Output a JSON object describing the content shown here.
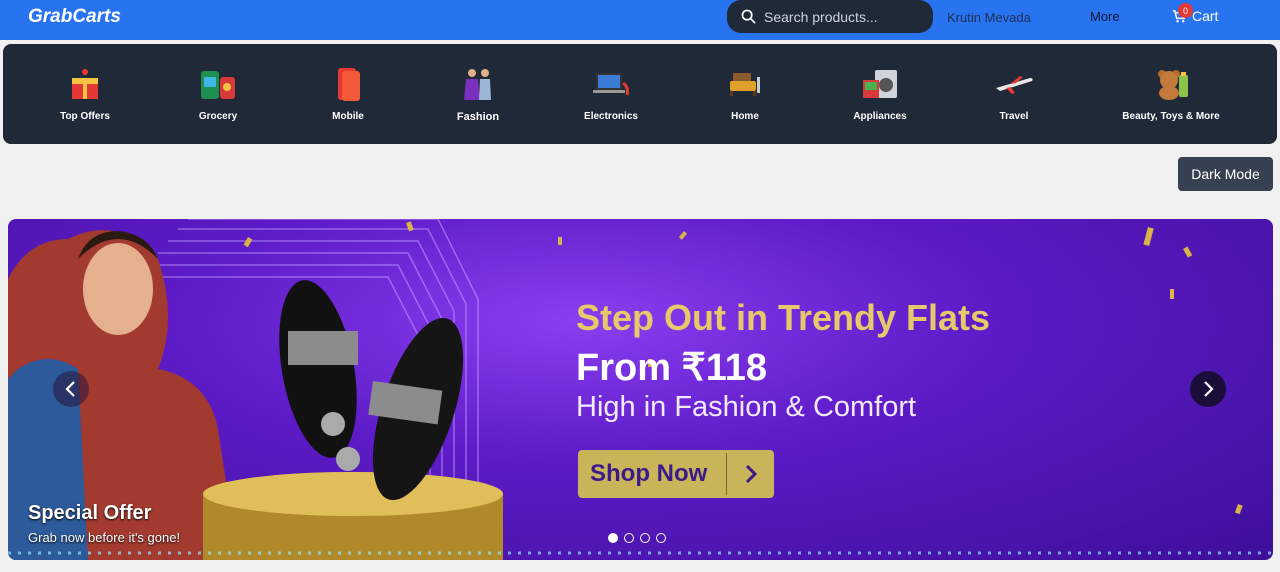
{
  "header": {
    "logo": "GrabCarts",
    "search_placeholder": "Search products...",
    "user_name": "Krutin Mevada",
    "more_label": "More",
    "cart_label": "Cart",
    "cart_count": "0"
  },
  "categories": [
    {
      "label": "Top Offers",
      "icon": "gift-icon"
    },
    {
      "label": "Grocery",
      "icon": "grocery-icon"
    },
    {
      "label": "Mobile",
      "icon": "mobile-icon"
    },
    {
      "label": "Fashion",
      "icon": "fashion-icon"
    },
    {
      "label": "Electronics",
      "icon": "laptop-icon"
    },
    {
      "label": "Home",
      "icon": "sofa-icon"
    },
    {
      "label": "Appliances",
      "icon": "appliance-icon"
    },
    {
      "label": "Travel",
      "icon": "airplane-icon"
    },
    {
      "label": "Beauty, Toys & More",
      "icon": "teddy-bear-icon"
    }
  ],
  "dark_mode_label": "Dark Mode",
  "banner": {
    "headline": "Step Out in Trendy Flats",
    "price": "From ₹118",
    "tagline": "High in Fashion & Comfort",
    "cta": "Shop Now",
    "offer_title": "Special Offer",
    "offer_subtitle": "Grab now before it's gone!",
    "slide_count": 4,
    "active_slide": 0
  },
  "colors": {
    "header": "#2874f0",
    "catbar": "#1f2937",
    "headline_gold": "#e7c86a",
    "cta_gold": "#c9b45a"
  }
}
